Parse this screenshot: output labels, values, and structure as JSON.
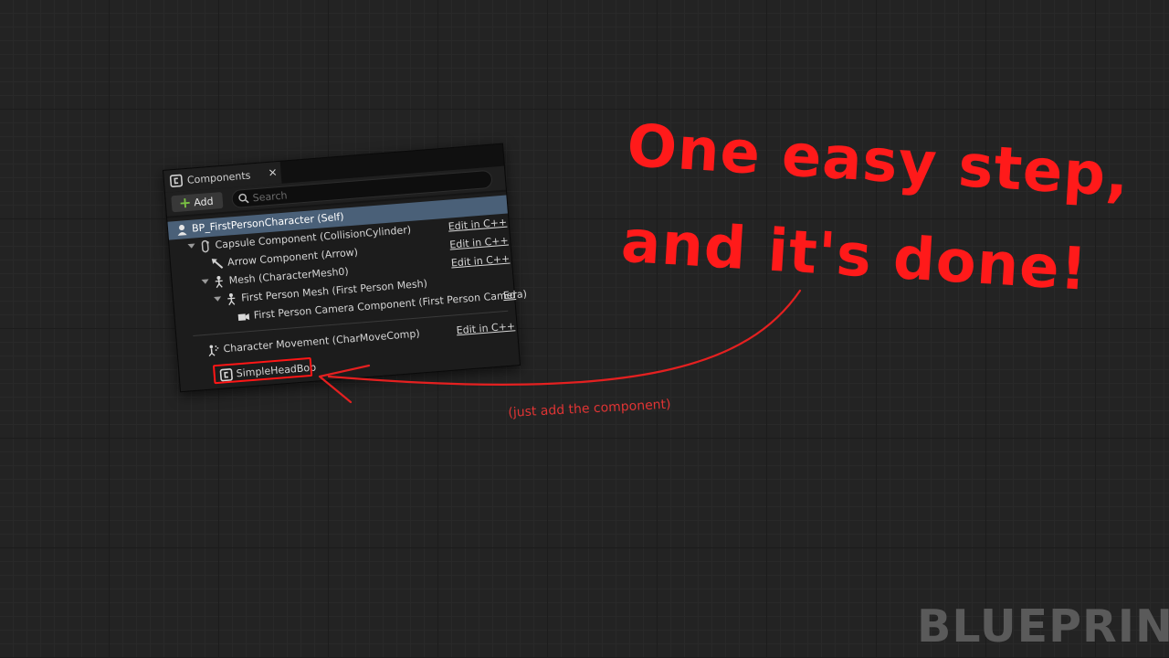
{
  "panel": {
    "tab_title": "Components",
    "tab_close": "×",
    "add_label": "Add",
    "search_placeholder": "Search",
    "rows": [
      {
        "label": "BP_FirstPersonCharacter (Self)",
        "edit": "",
        "icon": "person-icon",
        "selected": true
      },
      {
        "label": "Capsule Component (CollisionCylinder)",
        "edit": "Edit in C++",
        "icon": "capsule-icon"
      },
      {
        "label": "Arrow Component (Arrow)",
        "edit": "Edit in C++",
        "icon": "arrow-component-icon"
      },
      {
        "label": "Mesh (CharacterMesh0)",
        "edit": "Edit in C++",
        "icon": "skeleton-icon"
      },
      {
        "label": "First Person Mesh (First Person Mesh)",
        "edit": "Edit in C++",
        "icon": "skeleton-icon"
      },
      {
        "label": "First Person Camera Component (First Person Camera)",
        "edit": "Ed",
        "icon": "camera-icon"
      },
      {
        "label": "Character Movement (CharMoveComp)",
        "edit": "Edit in C++",
        "icon": "movement-icon"
      },
      {
        "label": "SimpleHeadBob",
        "edit": "",
        "icon": "component-icon"
      }
    ]
  },
  "annotation": {
    "headline_line1": "One easy step,",
    "headline_line2": "and it's done!",
    "note": "(just add the component)"
  },
  "watermark": "BLUEPRINT",
  "colors": {
    "accent_red": "#ff1a1a",
    "selection": "#4a6078",
    "add_plus": "#7ac143"
  }
}
